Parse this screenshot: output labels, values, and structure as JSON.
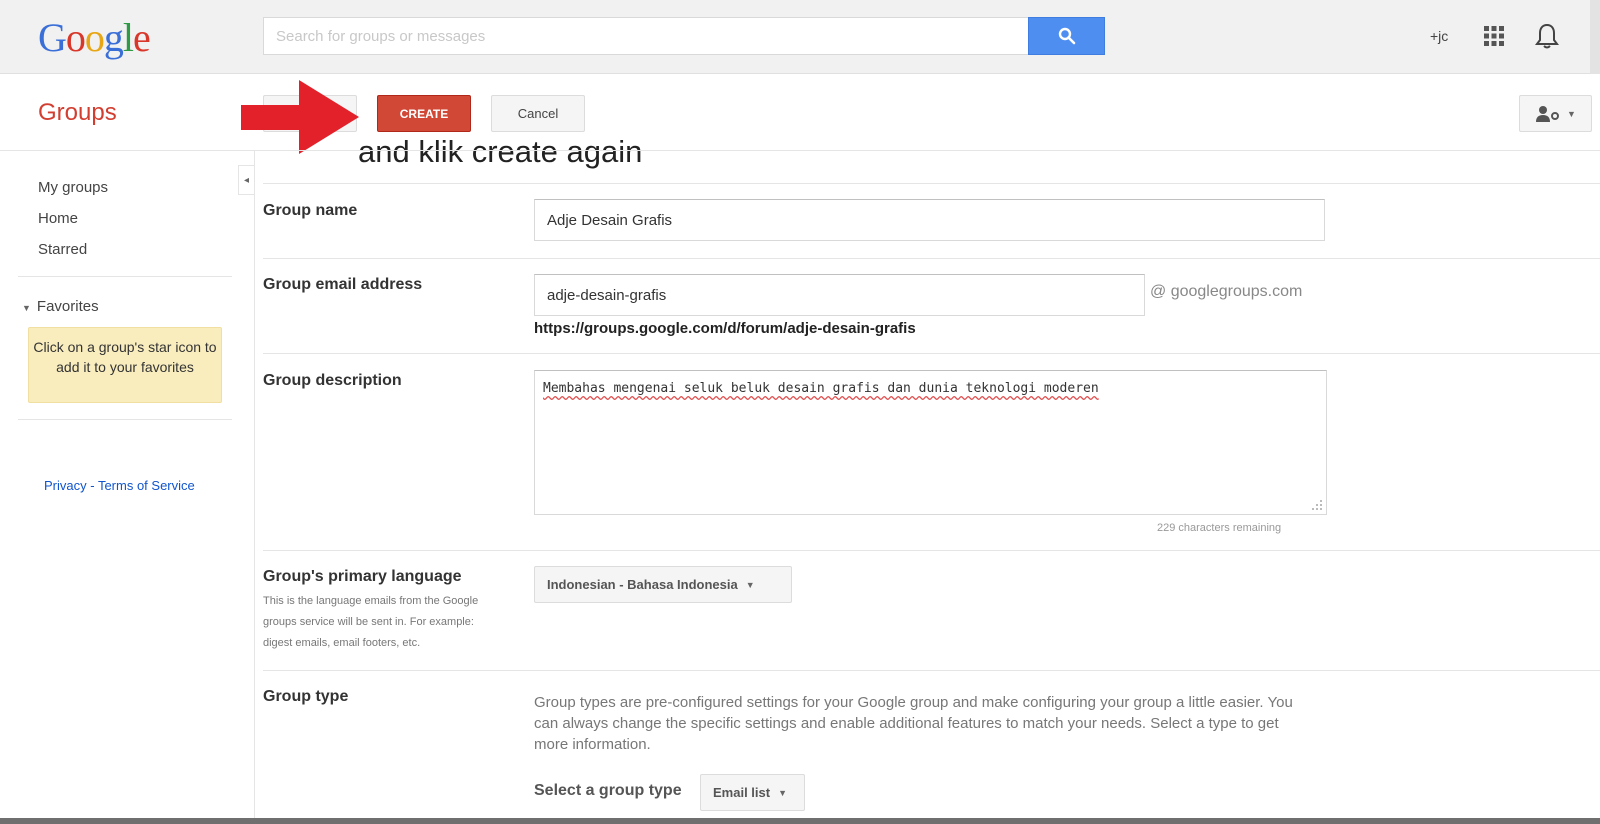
{
  "header": {
    "logo_letters": [
      {
        "ch": "G",
        "color": "#3b6fd8"
      },
      {
        "ch": "o",
        "color": "#d8372a"
      },
      {
        "ch": "o",
        "color": "#e7a614"
      },
      {
        "ch": "g",
        "color": "#3b6fd8"
      },
      {
        "ch": "l",
        "color": "#2f9a45"
      },
      {
        "ch": "e",
        "color": "#d8372a"
      }
    ],
    "search_placeholder": "Search for groups or messages",
    "search_icon": "search-icon",
    "profile_link": "+jc",
    "apps_icon": "apps-grid-icon",
    "notifications_icon": "bell-icon"
  },
  "toolbar": {
    "title": "Groups",
    "create_label": "CREATE",
    "cancel_label": "Cancel",
    "account_icon": "person-settings-icon",
    "annotation": "and klik create again",
    "annotation_arrow_color": "#e3212b"
  },
  "sidebar": {
    "nav": [
      "My groups",
      "Home",
      "Starred"
    ],
    "favorites_label": "Favorites",
    "favorites_hint": "Click on a group's star icon to add it to your favorites",
    "privacy_label": "Privacy",
    "separator": " - ",
    "terms_label": "Terms of Service"
  },
  "form": {
    "name_label": "Group name",
    "name_value": "Adje Desain Grafis",
    "email_label": "Group email address",
    "email_value": "adje-desain-grafis",
    "email_suffix": "@ googlegroups.com",
    "group_url": "https://groups.google.com/d/forum/adje-desain-grafis",
    "description_label": "Group description",
    "description_value": "Membahas mengenai seluk beluk desain grafis dan dunia teknologi moderen",
    "chars_remaining": "229 characters remaining",
    "language_label": "Group's primary language",
    "language_help": "This is the language emails from the Google groups service will be sent in. For example: digest emails, email footers, etc.",
    "language_value": "Indonesian - Bahasa Indonesia",
    "type_label": "Group type",
    "type_description": "Group types are pre-configured settings for your Google group and make configuring your group a little easier. You can always change the specific settings and enable additional features to match your needs. Select a type to get more information.",
    "select_type_label": "Select a group type",
    "type_value": "Email list"
  }
}
